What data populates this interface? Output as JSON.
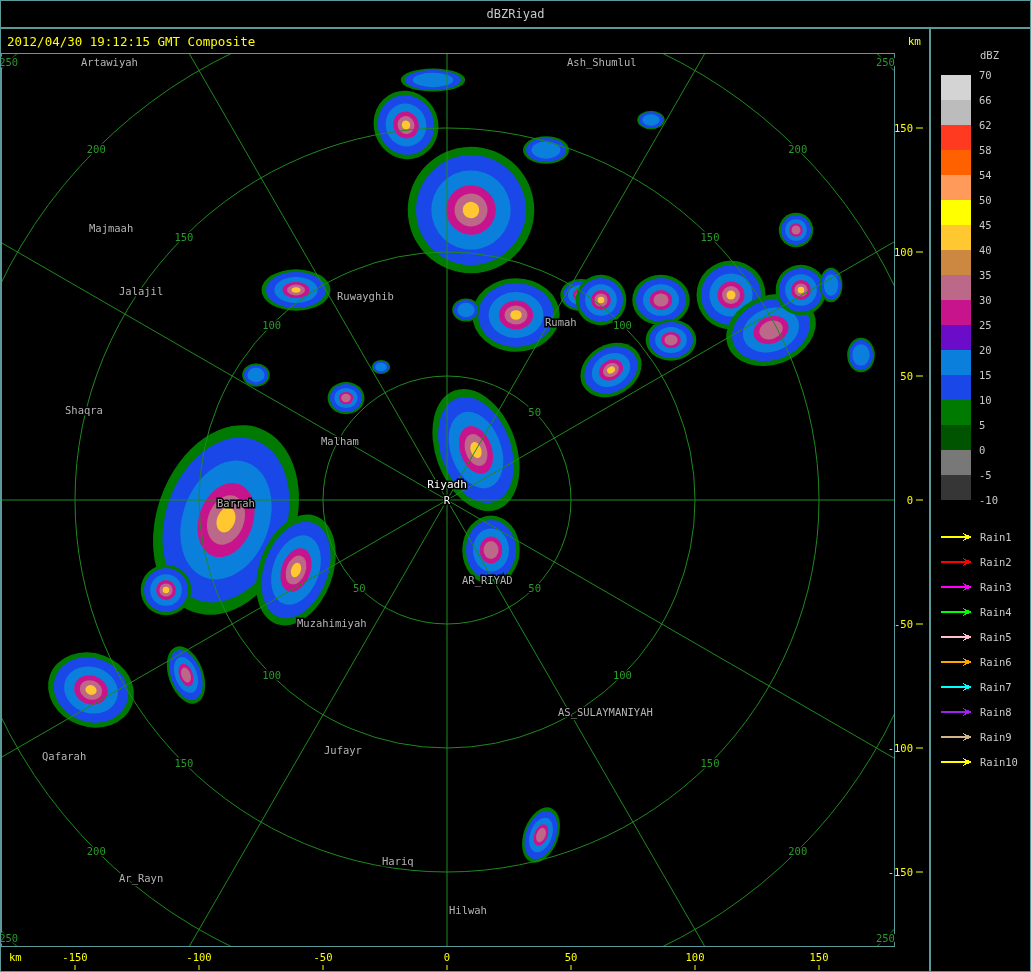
{
  "window": {
    "title": "dBZRiyad"
  },
  "header": {
    "timestamp": "2012/04/30 19:12:15 GMT Composite",
    "unit": "km"
  },
  "places": [
    {
      "name": "Artawiyah"
    },
    {
      "name": "Ash_Shumlul"
    },
    {
      "name": "Majmaah"
    },
    {
      "name": "Jalajil"
    },
    {
      "name": "Ruwayghib"
    },
    {
      "name": "Rumah"
    },
    {
      "name": "Shaqra"
    },
    {
      "name": "Malham"
    },
    {
      "name": "Barrah"
    },
    {
      "name": "AR_RIYAD"
    },
    {
      "name": "Muzahimiyah"
    },
    {
      "name": "AS_SULAYMANIYAH"
    },
    {
      "name": "Qafarah"
    },
    {
      "name": "Jufayr"
    },
    {
      "name": "Hariq"
    },
    {
      "name": "Ar_Rayn"
    },
    {
      "name": "Hilwah"
    }
  ],
  "radar_site": {
    "name": "Riyadh",
    "marker": "R"
  },
  "range_labels": {
    "north_east": [
      "50",
      "100",
      "150",
      "200",
      "250"
    ],
    "north_west": [
      "100",
      "150",
      "200",
      "250"
    ],
    "south_west": [
      "50",
      "100",
      "150",
      "200",
      "250"
    ],
    "south_east": [
      "50",
      "100",
      "150",
      "200",
      "250"
    ]
  },
  "x_axis": {
    "unit": "km",
    "ticks": [
      "-150",
      "-100",
      "-50",
      "0",
      "50",
      "100",
      "150"
    ]
  },
  "y_axis": {
    "ticks": [
      "150",
      "100",
      "50",
      "0",
      "-50",
      "-100",
      "-150"
    ]
  },
  "legend": {
    "title": "dBZ",
    "bins": [
      {
        "color": "#d4d4d4"
      },
      {
        "color": "#bcbcbc"
      },
      {
        "color": "#ff3a20"
      },
      {
        "color": "#ff6000"
      },
      {
        "color": "#ff9a5a"
      },
      {
        "color": "#ffff00"
      },
      {
        "color": "#ffc830"
      },
      {
        "color": "#cc8840"
      },
      {
        "color": "#bc6888"
      },
      {
        "color": "#c8148c"
      },
      {
        "color": "#6a0cc8"
      },
      {
        "color": "#0a80dc"
      },
      {
        "color": "#1a48e8"
      },
      {
        "color": "#007a00"
      },
      {
        "color": "#005400"
      },
      {
        "color": "#787878"
      },
      {
        "color": "#363636"
      }
    ],
    "labels": [
      "70",
      "66",
      "62",
      "58",
      "54",
      "50",
      "45",
      "40",
      "35",
      "30",
      "25",
      "20",
      "15",
      "10",
      "5",
      "0",
      "-5",
      "-10"
    ]
  },
  "tracks": [
    {
      "name": "Rain1",
      "color": "#ffff00"
    },
    {
      "name": "Rain2",
      "color": "#ff0000"
    },
    {
      "name": "Rain3",
      "color": "#ff00ff"
    },
    {
      "name": "Rain4",
      "color": "#00ff00"
    },
    {
      "name": "Rain5",
      "color": "#ffc0cb"
    },
    {
      "name": "Rain6",
      "color": "#ffa500"
    },
    {
      "name": "Rain7",
      "color": "#00ffff"
    },
    {
      "name": "Rain8",
      "color": "#a020f0"
    },
    {
      "name": "Rain9",
      "color": "#d2b48c"
    },
    {
      "name": "Rain10",
      "color": "#ffff00"
    }
  ]
}
